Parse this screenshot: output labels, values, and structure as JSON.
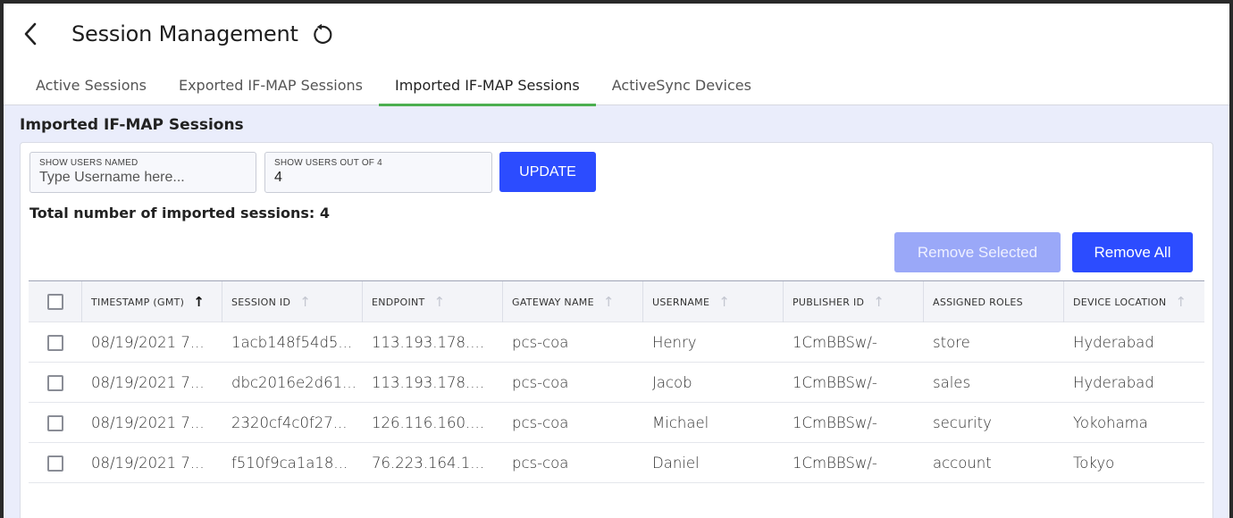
{
  "header": {
    "title": "Session Management",
    "back_icon": "chevron-left-icon",
    "refresh_icon": "refresh-icon"
  },
  "tabs": [
    {
      "label": "Active Sessions",
      "active": false
    },
    {
      "label": "Exported IF-MAP Sessions",
      "active": false
    },
    {
      "label": "Imported IF-MAP Sessions",
      "active": true
    },
    {
      "label": "ActiveSync Devices",
      "active": false
    }
  ],
  "section": {
    "title": "Imported IF-MAP Sessions"
  },
  "filters": {
    "username_label": "SHOW USERS NAMED",
    "username_placeholder": "Type Username here...",
    "username_value": "",
    "count_label": "SHOW USERS OUT OF 4",
    "count_value": "4",
    "update_label": "UPDATE"
  },
  "summary": {
    "total_text": "Total number of imported sessions: 4"
  },
  "actions": {
    "remove_selected_label": "Remove Selected",
    "remove_all_label": "Remove All"
  },
  "table": {
    "columns": [
      {
        "label": "TIMESTAMP (GMT)",
        "sort": "asc-active"
      },
      {
        "label": "SESSION ID",
        "sort": "inactive"
      },
      {
        "label": "ENDPOINT",
        "sort": "inactive"
      },
      {
        "label": "GATEWAY NAME",
        "sort": "inactive"
      },
      {
        "label": "USERNAME",
        "sort": "inactive"
      },
      {
        "label": "PUBLISHER ID",
        "sort": "inactive"
      },
      {
        "label": "ASSIGNED ROLES",
        "sort": "none"
      },
      {
        "label": "DEVICE LOCATION",
        "sort": "inactive"
      }
    ],
    "rows": [
      [
        "08/19/2021 7...",
        "1acb148f54d5...",
        "113.193.178....",
        "pcs-coa",
        "Henry",
        "1CmBBSw/-",
        "store",
        "Hyderabad"
      ],
      [
        "08/19/2021 7...",
        "dbc2016e2d61...",
        "113.193.178....",
        "pcs-coa",
        "Jacob",
        "1CmBBSw/-",
        "sales",
        "Hyderabad"
      ],
      [
        "08/19/2021 7...",
        "2320cf4c0f27...",
        "126.116.160....",
        "pcs-coa",
        "Michael",
        "1CmBBSw/-",
        "security",
        "Yokohama"
      ],
      [
        "08/19/2021 7...",
        "f510f9ca1a18...",
        "76.223.164.1...",
        "pcs-coa",
        "Daniel",
        "1CmBBSw/-",
        "account",
        "Tokyo"
      ]
    ]
  },
  "colors": {
    "accent": "#2c4cff",
    "accent_disabled": "#9aa8f8",
    "active_tab_underline": "#4caf50",
    "page_background": "#eaedfb"
  }
}
